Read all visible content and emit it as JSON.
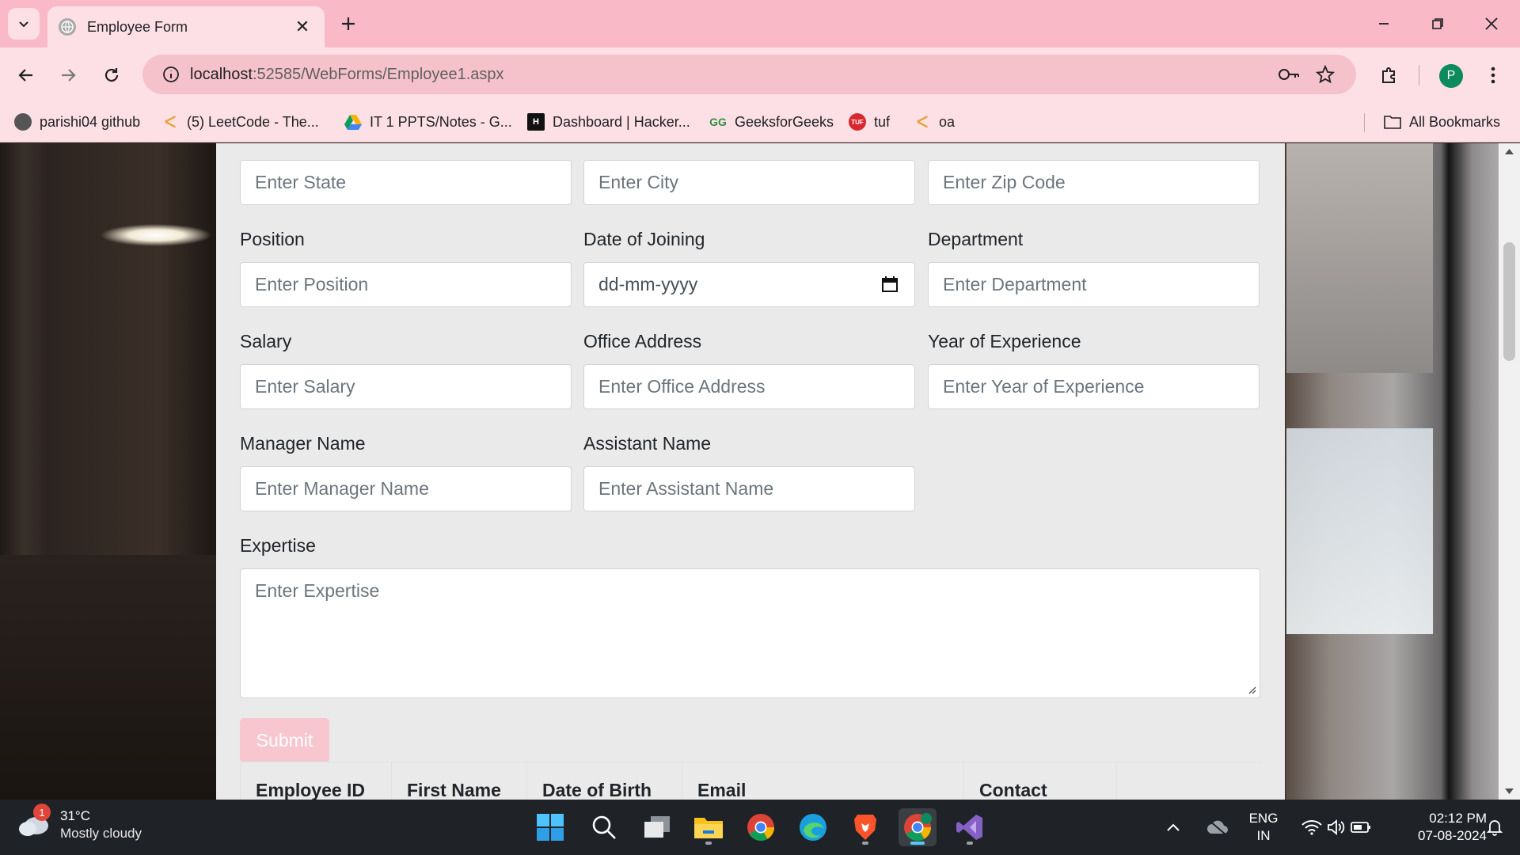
{
  "browser": {
    "tab_title": "Employee Form",
    "tab_close": "✕",
    "new_tab": "+",
    "url_host": "localhost",
    "url_path": ":52585/WebForms/Employee1.aspx",
    "profile_initial": "P"
  },
  "bookmarks": [
    {
      "label": "parishi04 github",
      "icon": "github-icon"
    },
    {
      "label": "(5) LeetCode - The...",
      "icon": "leetcode-icon"
    },
    {
      "label": "IT 1 PPTS/Notes - G...",
      "icon": "google-drive-icon"
    },
    {
      "label": "Dashboard | Hacker...",
      "icon": "hackerrank-icon"
    },
    {
      "label": "GeeksforGeeks",
      "icon": "gfg-icon"
    },
    {
      "label": "tuf",
      "icon": "tuf-icon"
    },
    {
      "label": "oa",
      "icon": "leetcode-icon"
    }
  ],
  "all_bookmarks": "All Bookmarks",
  "form": {
    "state_placeholder": "Enter State",
    "city_placeholder": "Enter City",
    "zip_placeholder": "Enter Zip Code",
    "position_label": "Position",
    "position_placeholder": "Enter Position",
    "doj_label": "Date of Joining",
    "doj_placeholder": "dd-mm-yyyy",
    "department_label": "Department",
    "department_placeholder": "Enter Department",
    "salary_label": "Salary",
    "salary_placeholder": "Enter Salary",
    "office_label": "Office Address",
    "office_placeholder": "Enter Office Address",
    "experience_label": "Year of Experience",
    "experience_placeholder": "Enter Year of Experience",
    "manager_label": "Manager Name",
    "manager_placeholder": "Enter Manager Name",
    "assistant_label": "Assistant Name",
    "assistant_placeholder": "Enter Assistant Name",
    "expertise_label": "Expertise",
    "expertise_placeholder": "Enter Expertise",
    "submit": "Submit"
  },
  "grid": {
    "columns": [
      "Employee ID",
      "First Name",
      "Date of Birth",
      "Email",
      "Contact"
    ]
  },
  "taskbar": {
    "weather_temp": "31°C",
    "weather_cond": "Mostly cloudy",
    "weather_badge": "1",
    "lang_1": "ENG",
    "lang_2": "IN",
    "time": "02:12 PM",
    "date": "07-08-2024"
  },
  "colors": {
    "tabbar": "#f9b9c6",
    "toolbar": "#fde0e6",
    "submit": "#f7c6cf",
    "taskbar": "#1f2327"
  }
}
